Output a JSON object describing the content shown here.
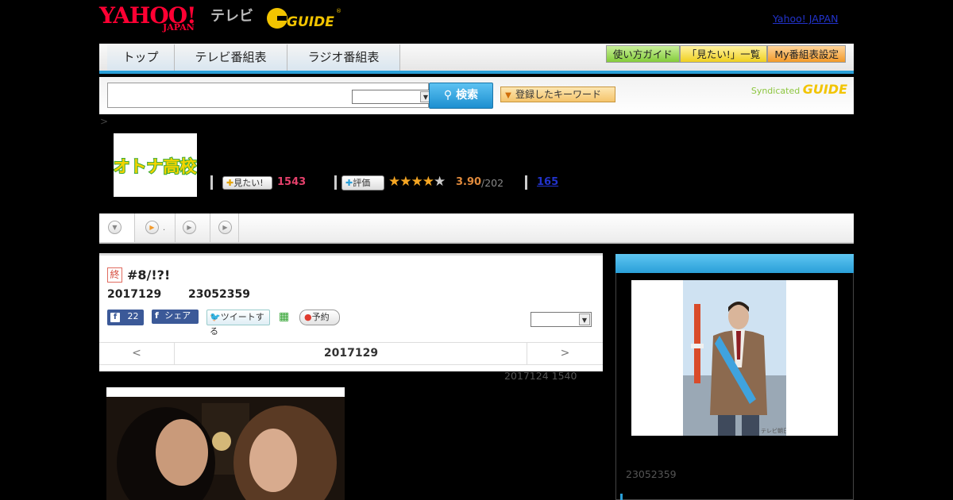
{
  "header": {
    "logo_yahoo": "YAHOO!",
    "logo_yahoo_sub": "JAPAN",
    "logo_tv": "テレビ",
    "logo_gguide": "G GUIDE",
    "yahoo_japan_link": "Yahoo! JAPAN"
  },
  "nav": {
    "tabs": [
      "トップ",
      "テレビ番組表",
      "ラジオ番組表"
    ],
    "buttons": [
      "使い方ガイド",
      "「見たい!」一覧",
      "My番組表設定"
    ]
  },
  "search": {
    "button_label": "検索",
    "keyword_label": "登録したキーワード",
    "syndicated_label": "Syndicated",
    "syndicated_logo": "GUIDE"
  },
  "breadcrumb": ">",
  "program": {
    "logo_text": "オトナ高校",
    "want_label": "見たい!",
    "want_count": "1543",
    "rate_label": "評価",
    "rating": "3.90",
    "rating_count": "/202",
    "review_count": "165",
    "rating_value": 3.9
  },
  "episode": {
    "end_badge": "終",
    "title": "#8/!?!",
    "date": "2017129",
    "id": "23052359",
    "like_count": "22",
    "share_label": "シェア",
    "tweet_label": "ツイートする",
    "reserve_label": "予約",
    "nav_prev": "<",
    "nav_current": "2017129",
    "nav_next": ">",
    "updated": "2017124  1540"
  },
  "sidebar": {
    "cast_id": "23052359",
    "photo_credit": "テレビ朝日"
  },
  "colors": {
    "accent_blue": "#2a9fd8",
    "want_pink": "#e4406b",
    "rating_orange": "#e08a3c",
    "link_blue": "#2233cc"
  }
}
